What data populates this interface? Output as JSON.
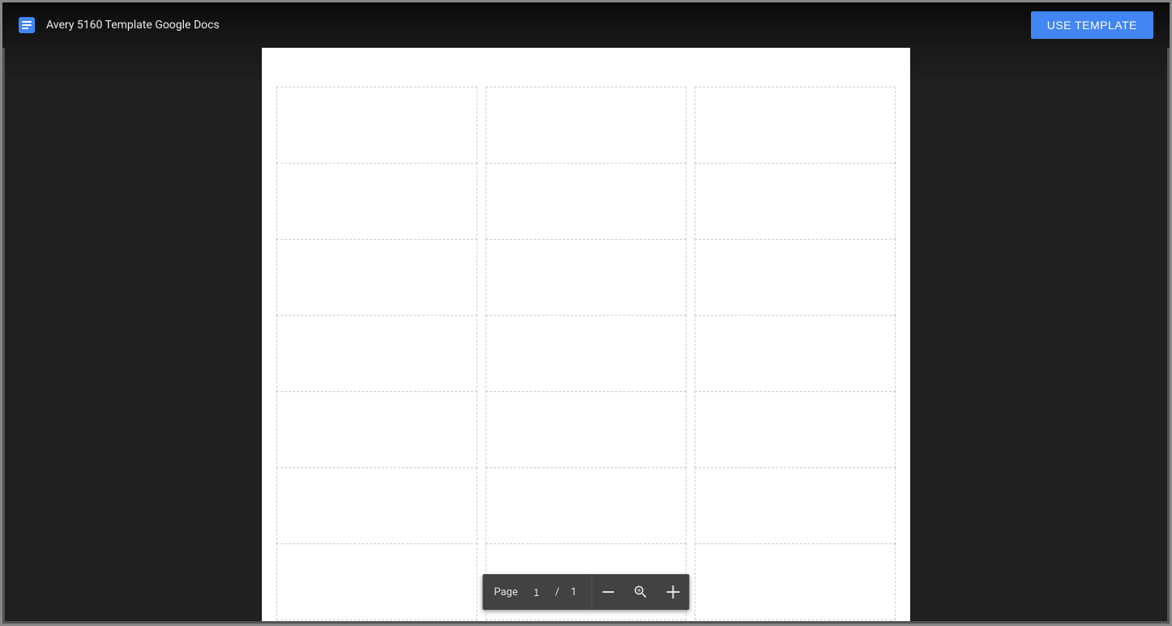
{
  "header": {
    "title": "Avery 5160 Template Google Docs",
    "use_template_label": "USE TEMPLATE",
    "icon_name": "google-docs-icon"
  },
  "document": {
    "label_rows_visible": 7,
    "label_columns": 3
  },
  "toolbar": {
    "page_label": "Page",
    "current_page": "1",
    "page_separator": "/",
    "total_pages": "1",
    "zoom_out_icon": "minus-icon",
    "fit_icon": "zoom-fit-icon",
    "zoom_in_icon": "plus-icon"
  },
  "colors": {
    "accent": "#4285f4",
    "toolbar_bg": "#424242",
    "viewer_bg": "#202020",
    "cell_border": "#cccccc"
  }
}
